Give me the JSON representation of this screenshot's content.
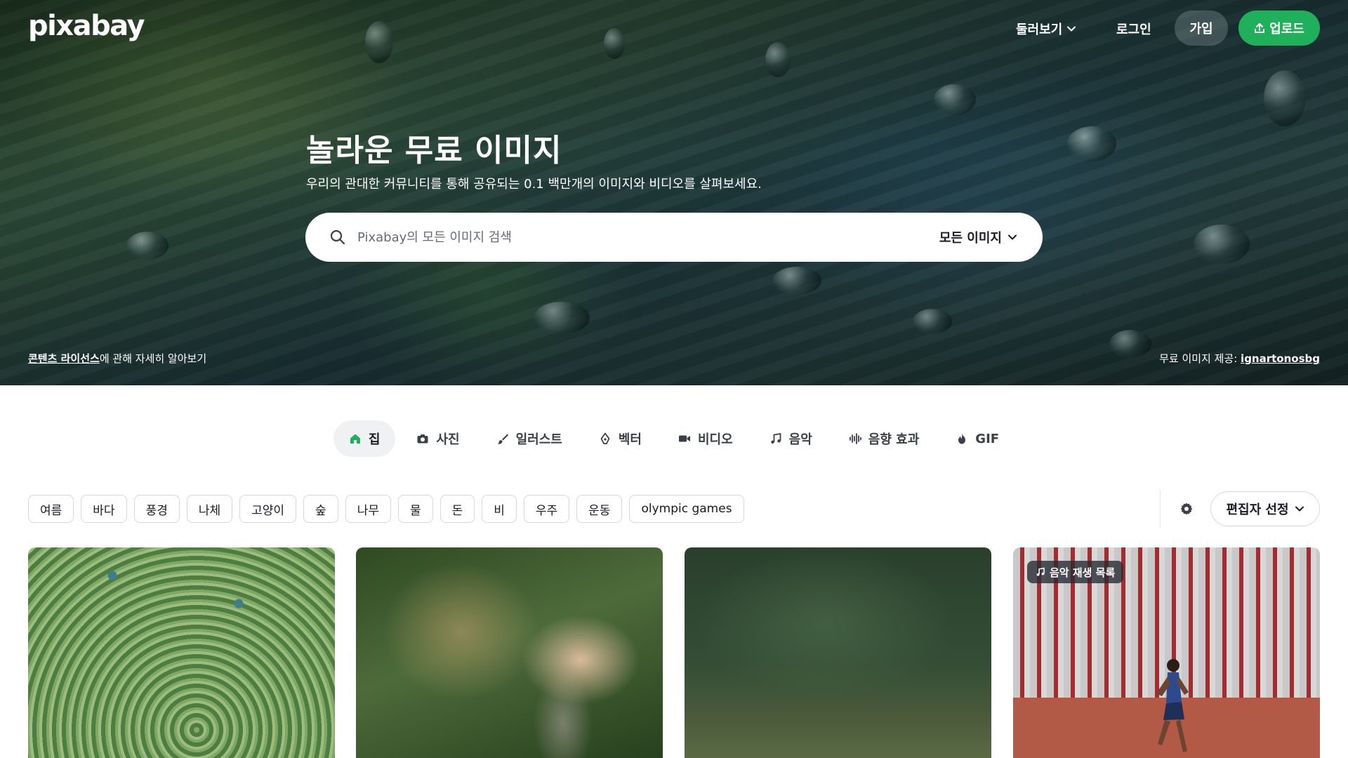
{
  "header": {
    "logo": "pixabay",
    "explore_label": "둘러보기",
    "login_label": "로그인",
    "join_label": "가입",
    "upload_label": "업로드"
  },
  "hero": {
    "title": "놀라운 무료 이미지",
    "subtitle": "우리의 관대한 커뮤니티를 통해 공유되는 0.1 백만개의 이미지와 비디오를 살펴보세요.",
    "search": {
      "placeholder": "Pixabay의 모든 이미지 검색",
      "type_label": "모든 이미지"
    },
    "license_link": "콘텐츠 라이선스",
    "license_suffix": "에 관해 자세히 알아보기",
    "credit_prefix": "무료 이미지 제공: ",
    "credit_user": "ignartonosbg"
  },
  "media_tabs": [
    {
      "label": "집",
      "icon": "home-icon",
      "active": true
    },
    {
      "label": "사진",
      "icon": "camera-icon",
      "active": false
    },
    {
      "label": "일러스트",
      "icon": "brush-icon",
      "active": false
    },
    {
      "label": "벡터",
      "icon": "pen-nib-icon",
      "active": false
    },
    {
      "label": "비디오",
      "icon": "video-camera-icon",
      "active": false
    },
    {
      "label": "음악",
      "icon": "music-note-icon",
      "active": false
    },
    {
      "label": "음향 효과",
      "icon": "sound-wave-icon",
      "active": false
    },
    {
      "label": "GIF",
      "icon": "flame-icon",
      "active": false
    }
  ],
  "tags": [
    "여름",
    "바다",
    "풍경",
    "나체",
    "고양이",
    "숲",
    "나무",
    "물",
    "돈",
    "비",
    "우주",
    "운동",
    "olympic games"
  ],
  "sort": {
    "label": "편집자 선정"
  },
  "cards": [
    {
      "subject": "peacock feathers"
    },
    {
      "subject": "stone statue among plants"
    },
    {
      "subject": "dark green forest"
    },
    {
      "subject": "runner in stadium",
      "badge": "음악 재생 목록"
    }
  ],
  "colors": {
    "accent": "#20b05c",
    "text": "#191b26",
    "chip_border": "#d6d8dd"
  }
}
